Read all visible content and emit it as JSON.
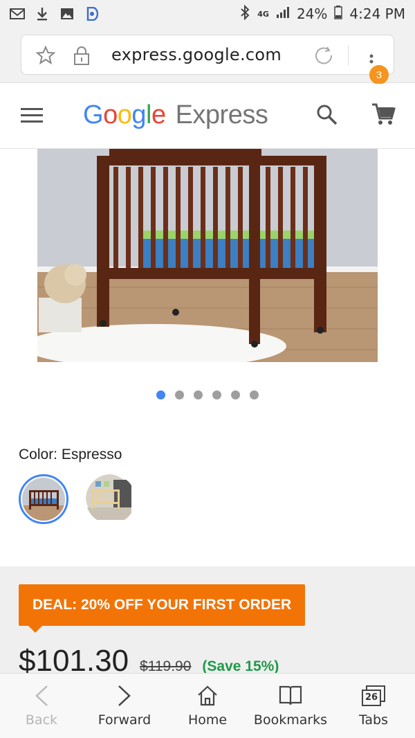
{
  "statusbar": {
    "left_icons": [
      "gmail-icon",
      "download-icon",
      "image-icon",
      "app-icon"
    ],
    "network": "4G",
    "battery": "24%",
    "time": "4:24 PM"
  },
  "browser": {
    "url": "express.google.com",
    "tab_badge": "3"
  },
  "app": {
    "logo_letters": [
      "G",
      "o",
      "o",
      "g",
      "l",
      "e"
    ],
    "logo_product": "Express"
  },
  "product": {
    "image_dots": 6,
    "active_dot": 0,
    "color_label": "Color: Espresso",
    "swatches": [
      "Espresso",
      "Natural"
    ],
    "deal_banner": "DEAL: 20% OFF YOUR FIRST ORDER",
    "price": "$101.30",
    "original_price": "$119.90",
    "savings": "(Save 15%)"
  },
  "nav": {
    "back": "Back",
    "forward": "Forward",
    "home": "Home",
    "bookmarks": "Bookmarks",
    "tabs": "Tabs",
    "tabs_count": "26"
  },
  "colors": {
    "accent": "#4285f4",
    "deal": "#f27407",
    "save": "#1e9a4a",
    "badge": "#f5941f"
  }
}
